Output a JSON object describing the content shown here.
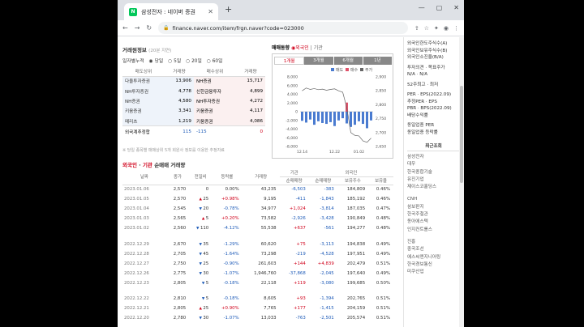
{
  "browser": {
    "tab_title": "삼성전자 : 네이버 증권",
    "url": "finance.naver.com/item/frgn.naver?code=023000",
    "new_tab": "+",
    "win_controls": [
      "—",
      "▢",
      "✕"
    ]
  },
  "trade": {
    "title": "거래원정보",
    "subtitle": "(20분 지연)",
    "period_label": "일자별누적",
    "radios": [
      "당일",
      "5일",
      "20일",
      "60일"
    ],
    "col_sell": "매도상위",
    "col_volume": "거래량",
    "col_buy": "매수상위",
    "col_volume2": "거래량",
    "rows": [
      {
        "sell": "다올투자증권",
        "sv": "13,906",
        "buy": "NH증권",
        "bv": "15,717"
      },
      {
        "sell": "NH투자증권",
        "sv": "4,778",
        "buy": "신한금융투자",
        "bv": "4,899"
      },
      {
        "sell": "NH증권",
        "sv": "4,580",
        "buy": "NH투자증권",
        "bv": "4,272"
      },
      {
        "sell": "키움증권",
        "sv": "3,341",
        "buy": "키움증권",
        "bv": "4,117"
      },
      {
        "sell": "메리츠",
        "sv": "1,219",
        "buy": "키움증권",
        "bv": "4,086"
      }
    ],
    "foreign_label": "외국계추정합",
    "foreign_sell": "115",
    "foreign_mid": "-115",
    "foreign_buy": "0",
    "note": "※ 당일 종목별 매매상위 5개 회원사 정보를 이용한 추정자료"
  },
  "chart": {
    "title": "매매동향",
    "legend_foreign": "외국인",
    "legend_inst": "기관",
    "tabs": [
      "1개월",
      "3개월",
      "6개월",
      "1년"
    ],
    "series_legend": [
      "매도",
      "매수",
      "주가"
    ],
    "yl_ticks": [
      "8,000",
      "6,000",
      "4,000",
      "2,000",
      "0",
      "-2,000",
      "-4,000",
      "-6,000",
      "-8,000"
    ],
    "yr_ticks": [
      "2,900",
      "2,850",
      "2,800",
      "2,750",
      "2,700",
      "2,650"
    ],
    "x_ticks": [
      "12.14",
      "12.22",
      "01.02"
    ]
  },
  "chart_data": {
    "type": "bar",
    "ylim": [
      -8000,
      8000
    ],
    "categories": [
      "12.14",
      "",
      "",
      "",
      "",
      "",
      "",
      "",
      "12.22",
      "",
      "",
      "",
      "",
      "",
      "01.02",
      "",
      "",
      ""
    ],
    "series": [
      {
        "name": "매도",
        "values": [
          -2100,
          -2500,
          -1800,
          -3000,
          -2200,
          -2600,
          -2800,
          -2400,
          -3300,
          -2000,
          -1500,
          -2700,
          -3500,
          -3000,
          -2200,
          -2800,
          -3800,
          -2000
        ]
      },
      {
        "name": "매수",
        "values": [
          0,
          0,
          0,
          0,
          0,
          0,
          0,
          0,
          0,
          0,
          0,
          2100,
          0,
          0,
          0,
          0,
          0,
          0
        ]
      }
    ],
    "price": [
      2850,
      2860,
      2855,
      2858,
      2854,
      2856,
      2852,
      2855,
      2857,
      2850,
      2845,
      2790,
      2700,
      2690,
      2688,
      2670,
      2665,
      2680
    ]
  },
  "net": {
    "title_foreign": "외국인",
    "title_inst": "기관",
    "title_rest": "순매매 거래량",
    "h_date": "날짜",
    "h_close": "종가",
    "h_change": "전일비",
    "h_rate": "등락률",
    "h_volume": "거래량",
    "h_inst": "기관",
    "h_foreign": "외국인",
    "h_net": "순매매량",
    "h_net2": "순매매량",
    "h_hold": "보유주수",
    "h_ratio": "보유율",
    "rows": [
      {
        "d": "2023.01.06",
        "c": "2,570",
        "ch": "0",
        "dir": "",
        "r": "0.00%",
        "v": "43,235",
        "i": "-6,503",
        "f": "-383",
        "h": "184,809",
        "p": "0.46%"
      },
      {
        "d": "2023.01.05",
        "c": "2,570",
        "ch": "25",
        "dir": "up",
        "r": "+0.98%",
        "v": "9,195",
        "i": "-411",
        "f": "-1,843",
        "h": "185,192",
        "p": "0.46%"
      },
      {
        "d": "2023.01.04",
        "c": "2,545",
        "ch": "20",
        "dir": "down",
        "r": "-0.78%",
        "v": "34,977",
        "i": "+1,024",
        "f": "-3,814",
        "h": "187,035",
        "p": "0.47%"
      },
      {
        "d": "2023.01.03",
        "c": "2,565",
        "ch": "5",
        "dir": "up",
        "r": "+0.20%",
        "v": "73,582",
        "i": "-2,926",
        "f": "-3,428",
        "h": "190,849",
        "p": "0.48%"
      },
      {
        "d": "2023.01.02",
        "c": "2,560",
        "ch": "110",
        "dir": "down",
        "r": "-4.12%",
        "v": "55,538",
        "i": "+637",
        "f": "-561",
        "h": "194,277",
        "p": "0.48%"
      },
      {
        "gap": true
      },
      {
        "d": "2022.12.29",
        "c": "2,670",
        "ch": "35",
        "dir": "down",
        "r": "-1.29%",
        "v": "60,620",
        "i": "+75",
        "f": "-3,113",
        "h": "194,838",
        "p": "0.49%"
      },
      {
        "d": "2022.12.28",
        "c": "2,705",
        "ch": "45",
        "dir": "down",
        "r": "-1.64%",
        "v": "73,298",
        "i": "-219",
        "f": "-4,528",
        "h": "197,951",
        "p": "0.49%"
      },
      {
        "d": "2022.12.27",
        "c": "2,750",
        "ch": "25",
        "dir": "down",
        "r": "-0.90%",
        "v": "261,603",
        "i": "+144",
        "f": "+4,839",
        "h": "202,479",
        "p": "0.51%"
      },
      {
        "d": "2022.12.26",
        "c": "2,775",
        "ch": "30",
        "dir": "down",
        "r": "-1.07%",
        "v": "1,946,760",
        "i": "-37,868",
        "f": "-2,045",
        "h": "197,640",
        "p": "0.49%"
      },
      {
        "d": "2022.12.23",
        "c": "2,805",
        "ch": "5",
        "dir": "down",
        "r": "-0.18%",
        "v": "22,118",
        "i": "+119",
        "f": "-3,080",
        "h": "199,685",
        "p": "0.50%"
      },
      {
        "gap": true
      },
      {
        "d": "2022.12.22",
        "c": "2,810",
        "ch": "5",
        "dir": "down",
        "r": "-0.18%",
        "v": "8,605",
        "i": "+93",
        "f": "-1,394",
        "h": "202,765",
        "p": "0.51%"
      },
      {
        "d": "2022.12.21",
        "c": "2,805",
        "ch": "25",
        "dir": "up",
        "r": "+0.90%",
        "v": "7,765",
        "i": "+177",
        "f": "-1,415",
        "h": "204,159",
        "p": "0.51%"
      },
      {
        "d": "2022.12.20",
        "c": "2,780",
        "ch": "30",
        "dir": "down",
        "r": "-1.07%",
        "v": "13,033",
        "i": "-763",
        "f": "-2,501",
        "h": "205,574",
        "p": "0.51%"
      }
    ]
  },
  "side": {
    "top_items": [
      "외국인한도주식수(A)",
      "외국인보유주식수(B)",
      "외국인소진율(B/A)"
    ],
    "opinion": [
      "투자의견 · 목표주가",
      "N/A · N/A"
    ],
    "low_items": [
      "52주최고 · 최저"
    ],
    "per": [
      "PER · EPS(2022.09)",
      "추정PER · EPS",
      "PBR · BPS(2022.09)",
      "배당수익률"
    ],
    "industry": [
      "동일업종 PER",
      "동일업종 등락률"
    ],
    "recent_title": "최근조회",
    "recent": [
      "삼성전자",
      "대우",
      "한국종합기술",
      "유진기업",
      "제이스코홀딩스",
      "CNH",
      "삼보판지",
      "한국주철관",
      "동아에스텍",
      "인지컨트롤스",
      "진흥",
      "중국조선",
      "에스씨엔지니어링",
      "한국경보통신",
      "미쿠산업"
    ]
  },
  "colors": {
    "up": "#d0021b",
    "down": "#1e5bb8",
    "accent": "#03c75a"
  }
}
